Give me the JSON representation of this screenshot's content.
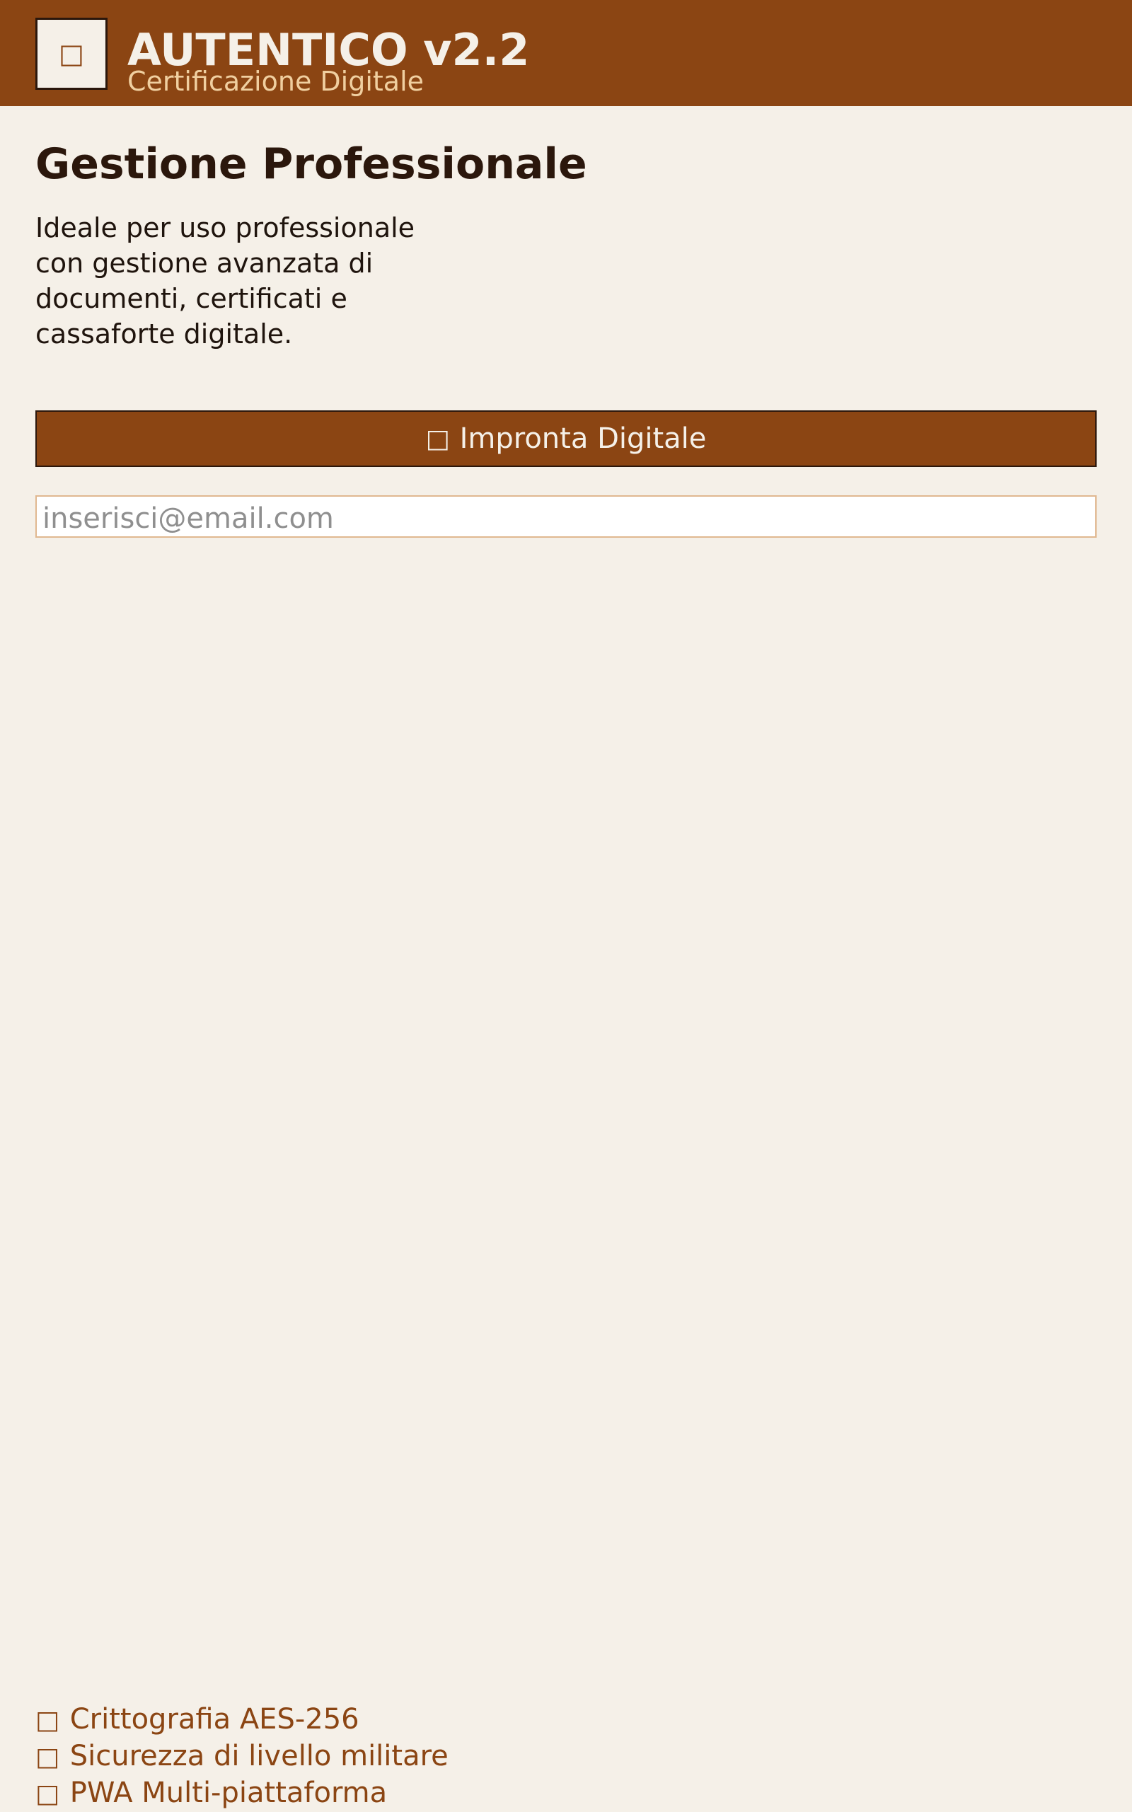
{
  "header": {
    "logo_icon": "□",
    "logo_icon_name": "shield-icon",
    "title": "AUTENTICO v2.2",
    "subtitle": "Certificazione Digitale"
  },
  "main": {
    "title": "Gestione Professionale",
    "description": "Ideale per uso professionale con gestione avanzata di documenti, certificati e cassaforte digitale.",
    "fingerprint_button": {
      "icon": "□",
      "icon_name": "fingerprint-icon",
      "label": "Impronta Digitale"
    },
    "email_input": {
      "value": "",
      "placeholder": "inserisci@email.com"
    }
  },
  "features": [
    {
      "icon": "□",
      "icon_name": "lock-icon",
      "label": "Crittografia AES-256"
    },
    {
      "icon": "□",
      "icon_name": "shield-icon",
      "label": "Sicurezza di livello militare"
    },
    {
      "icon": "□",
      "icon_name": "mobile-icon",
      "label": "PWA Multi-piattaforma"
    }
  ],
  "colors": {
    "brand": "#8b4513",
    "background": "#f5f0e8",
    "text_dark": "#2b170c",
    "accent_light": "#f0cfa0",
    "input_border": "#e0b890"
  }
}
